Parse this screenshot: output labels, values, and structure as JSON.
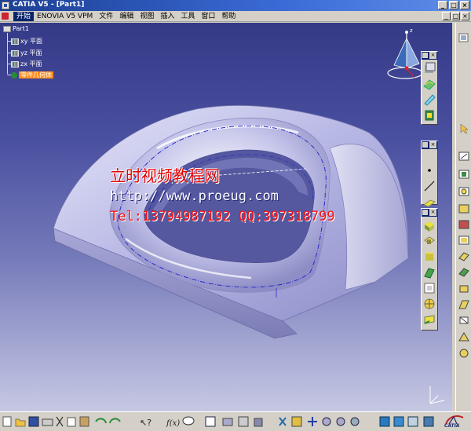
{
  "window": {
    "title": "CATIA V5 - [Part1]",
    "buttons": {
      "minimize": "_",
      "maximize": "□",
      "close": "×"
    }
  },
  "menu": {
    "items": [
      "开始",
      "ENOVIA V5 VPM",
      "文件",
      "编辑",
      "视图",
      "插入",
      "工具",
      "窗口",
      "帮助"
    ],
    "active_index": 0,
    "mdi_buttons": {
      "minimize": "_",
      "restore": "□",
      "close": "×"
    }
  },
  "tree": {
    "root": "Part1",
    "items": [
      "xy 平面",
      "yz 平面",
      "zx 平面"
    ],
    "highlighted": "零件几何体"
  },
  "watermark": {
    "line1": "立时视频教程网",
    "line2": "http://www.proeug.com",
    "line3": "Tel:13794987192  QQ:397318799"
  },
  "compass": {
    "axis_label": "z"
  },
  "logo": {
    "text": "CATIA"
  },
  "colors": {
    "titlebar": "#1c3f94",
    "viewport_top": "#343a86",
    "viewport_bottom": "#c6c8e3",
    "model_surface": "#b8b8e4",
    "sketch_line": "#2a2acc",
    "watermark_red": "#e20000",
    "tree_highlight": "#ff8c1a"
  },
  "toolbars": {
    "right_floating_1": [
      "part-body-icon",
      "surface-icon",
      "sketch-icon",
      "solid-icon"
    ],
    "right_floating_2": [
      "point-icon",
      "line-icon",
      "plane-icon"
    ],
    "right_floating_3": [
      "extrude-icon",
      "pocket-icon",
      "shaft-icon",
      "rib-icon",
      "loft-icon",
      "fillet-icon",
      "chamfer-icon"
    ],
    "bottom": [
      "new-icon",
      "open-icon",
      "save-icon",
      "print-icon",
      "cut-icon",
      "copy-icon",
      "paste-icon",
      "undo-icon",
      "redo-icon",
      "help-icon",
      "fx-icon",
      "comment-icon",
      "table-icon",
      "measure-icon",
      "analysis-icon",
      "fly-icon",
      "fit-all-icon",
      "pan-icon",
      "rotate-icon",
      "zoom-in-icon",
      "zoom-out-icon",
      "normal-view-icon",
      "iso-view-icon",
      "shading-icon",
      "hide-show-icon",
      "swap-icon"
    ]
  }
}
